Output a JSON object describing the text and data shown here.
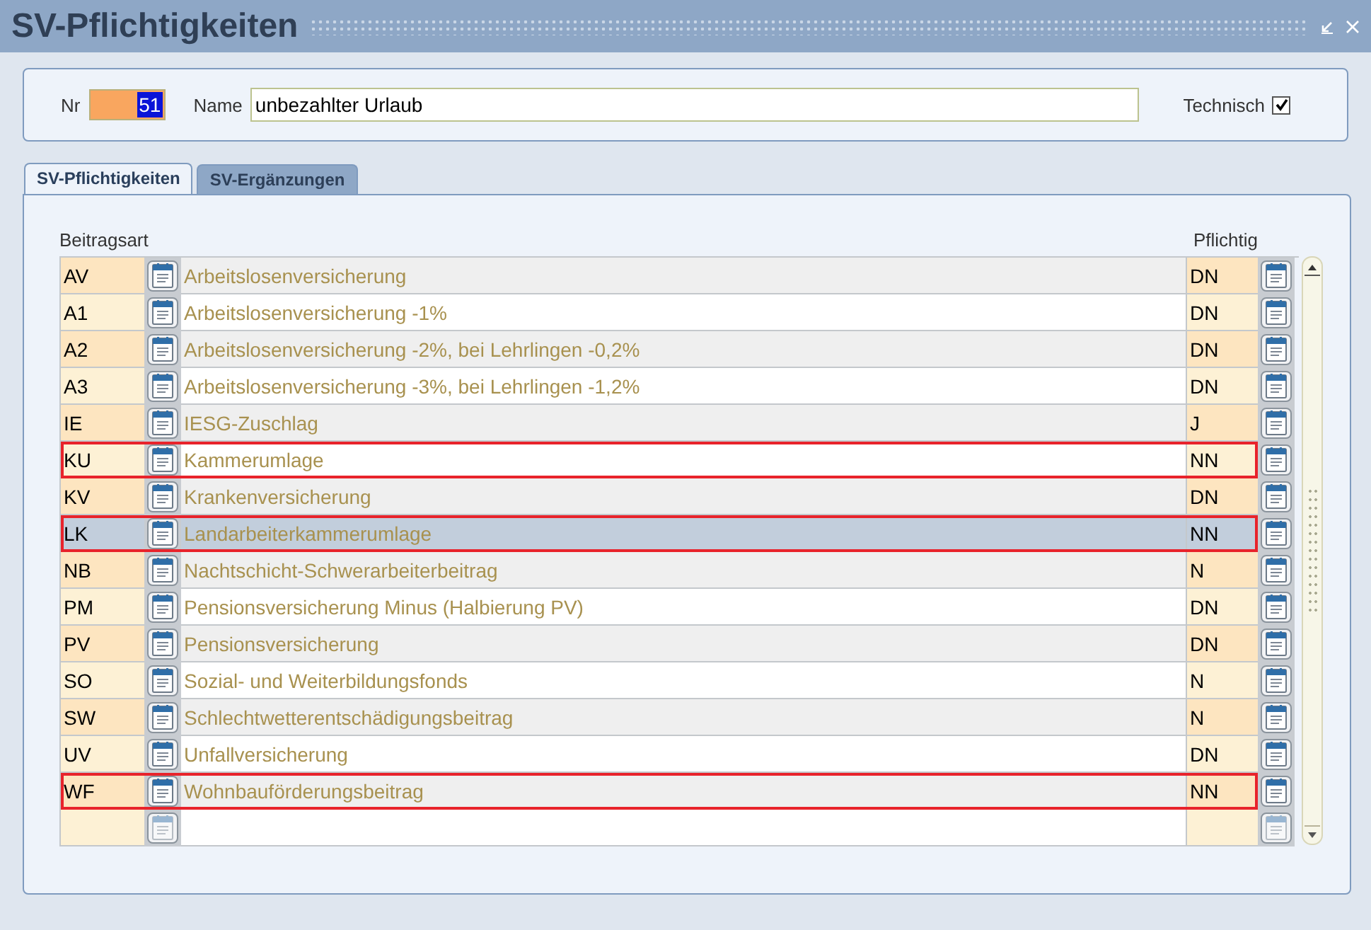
{
  "window": {
    "title": "SV-Pflichtigkeiten"
  },
  "header": {
    "nr_label": "Nr",
    "nr_value": "51",
    "name_label": "Name",
    "name_value": "unbezahlter Urlaub",
    "technisch_label": "Technisch",
    "technisch_checked": true
  },
  "tabs": [
    {
      "label": "SV-Pflichtigkeiten",
      "selected": true
    },
    {
      "label": "SV-Ergänzungen",
      "selected": false
    }
  ],
  "table": {
    "columns": [
      "Beitragsart",
      "Pflichtig"
    ],
    "rows": [
      {
        "kind": "entry",
        "code": "AV",
        "description": "Arbeitslosenversicherung",
        "pflichtig": "DN",
        "highlighted": false,
        "selected": false
      },
      {
        "kind": "entry",
        "code": "A1",
        "description": "Arbeitslosenversicherung -1%",
        "pflichtig": "DN",
        "highlighted": false,
        "selected": false
      },
      {
        "kind": "entry",
        "code": "A2",
        "description": "Arbeitslosenversicherung -2%, bei Lehrlingen -0,2%",
        "pflichtig": "DN",
        "highlighted": false,
        "selected": false
      },
      {
        "kind": "entry",
        "code": "A3",
        "description": "Arbeitslosenversicherung -3%, bei Lehrlingen -1,2%",
        "pflichtig": "DN",
        "highlighted": false,
        "selected": false
      },
      {
        "kind": "entry",
        "code": "IE",
        "description": "IESG-Zuschlag",
        "pflichtig": "J",
        "highlighted": false,
        "selected": false
      },
      {
        "kind": "entry",
        "code": "KU",
        "description": "Kammerumlage",
        "pflichtig": "NN",
        "highlighted": true,
        "selected": false
      },
      {
        "kind": "entry",
        "code": "KV",
        "description": "Krankenversicherung",
        "pflichtig": "DN",
        "highlighted": false,
        "selected": false
      },
      {
        "kind": "entry",
        "code": "LK",
        "description": "Landarbeiterkammerumlage",
        "pflichtig": "NN",
        "highlighted": true,
        "selected": true
      },
      {
        "kind": "entry",
        "code": "NB",
        "description": "Nachtschicht-Schwerarbeiterbeitrag",
        "pflichtig": "N",
        "highlighted": false,
        "selected": false
      },
      {
        "kind": "entry",
        "code": "PM",
        "description": "Pensionsversicherung Minus (Halbierung PV)",
        "pflichtig": "DN",
        "highlighted": false,
        "selected": false
      },
      {
        "kind": "entry",
        "code": "PV",
        "description": "Pensionsversicherung",
        "pflichtig": "DN",
        "highlighted": false,
        "selected": false
      },
      {
        "kind": "entry",
        "code": "SO",
        "description": "Sozial- und Weiterbildungsfonds",
        "pflichtig": "N",
        "highlighted": false,
        "selected": false
      },
      {
        "kind": "entry",
        "code": "SW",
        "description": "Schlechtwetterentschädigungsbeitrag",
        "pflichtig": "N",
        "highlighted": false,
        "selected": false
      },
      {
        "kind": "entry",
        "code": "UV",
        "description": "Unfallversicherung",
        "pflichtig": "DN",
        "highlighted": false,
        "selected": false
      },
      {
        "kind": "entry",
        "code": "WF",
        "description": "Wohnbauförderungsbeitrag",
        "pflichtig": "NN",
        "highlighted": true,
        "selected": false
      },
      {
        "kind": "empty"
      }
    ]
  }
}
